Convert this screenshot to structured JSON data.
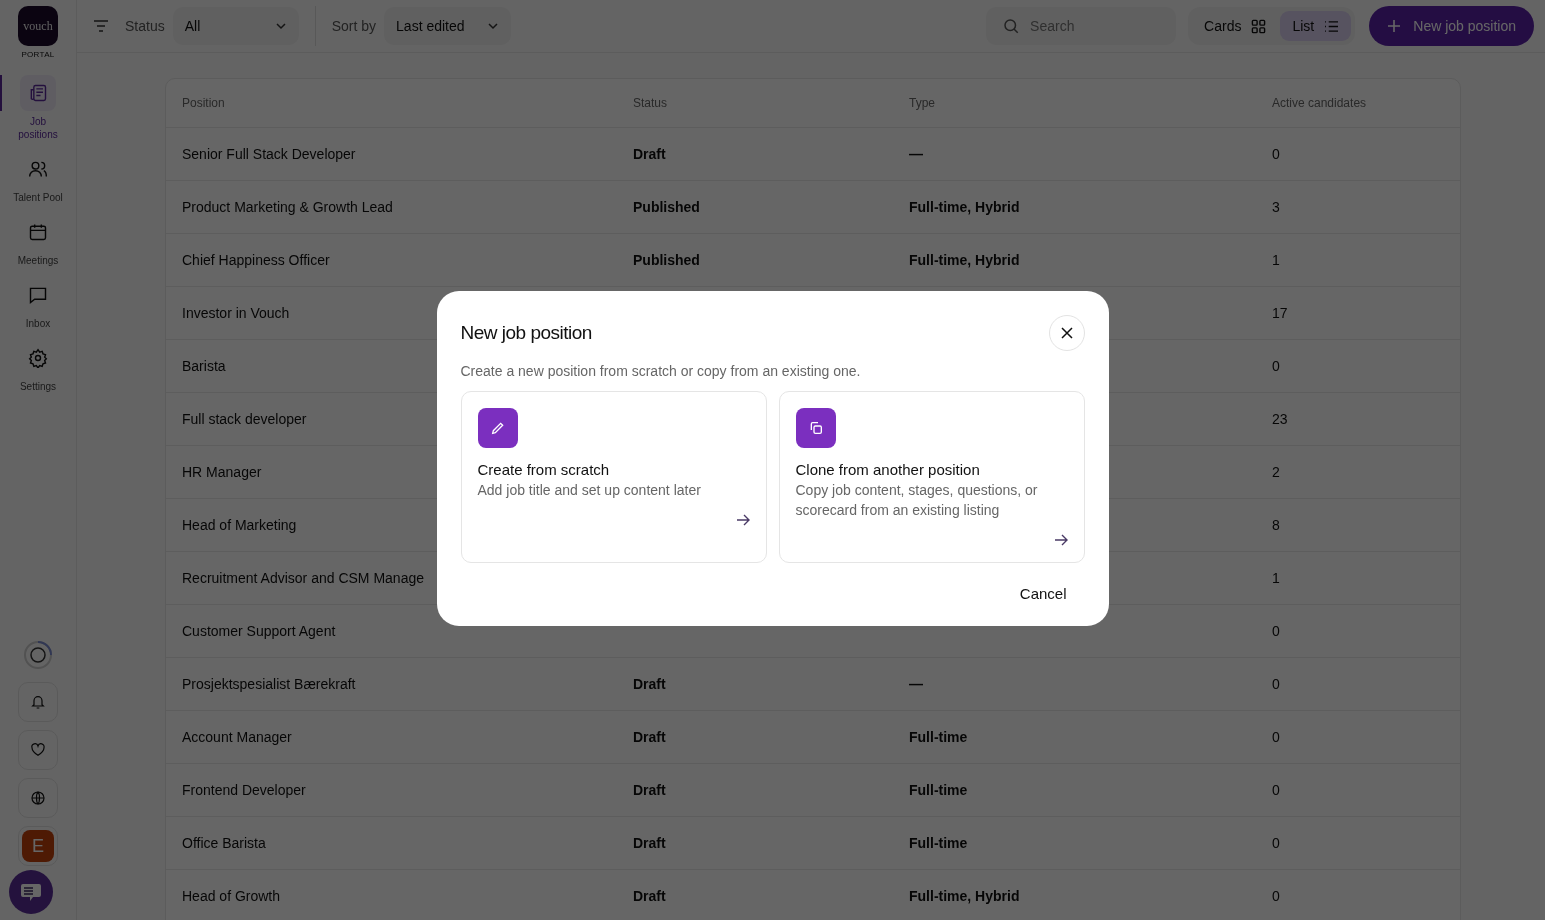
{
  "logo": {
    "text": "vouch",
    "caption": "PORTAL"
  },
  "sidebar": {
    "items": [
      {
        "label": "Job positions",
        "selected": true
      },
      {
        "label": "Talent Pool",
        "selected": false
      },
      {
        "label": "Meetings",
        "selected": false
      },
      {
        "label": "Inbox",
        "selected": false
      },
      {
        "label": "Settings",
        "selected": false
      }
    ],
    "avatar_initial": "E"
  },
  "toolbar": {
    "status_label": "Status",
    "status_value": "All",
    "sort_label": "Sort by",
    "sort_value": "Last edited",
    "search_placeholder": "Search",
    "views": [
      {
        "label": "Cards",
        "selected": false
      },
      {
        "label": "List",
        "selected": true
      }
    ],
    "new_button": "New job position"
  },
  "table": {
    "columns": [
      "Position",
      "Status",
      "Type",
      "Active candidates"
    ],
    "rows": [
      {
        "position": "Senior Full Stack Developer",
        "status": "Draft",
        "type": "—",
        "candidates": "0"
      },
      {
        "position": "Product Marketing & Growth Lead",
        "status": "Published",
        "type": "Full-time, Hybrid",
        "candidates": "3"
      },
      {
        "position": "Chief Happiness Officer",
        "status": "Published",
        "type": "Full-time, Hybrid",
        "candidates": "1"
      },
      {
        "position": "Investor in Vouch",
        "candidates": "17"
      },
      {
        "position": "Barista",
        "candidates": "0"
      },
      {
        "position": "Full stack developer",
        "candidates": "23"
      },
      {
        "position": "HR Manager",
        "candidates": "2"
      },
      {
        "position": "Head of Marketing",
        "candidates": "8"
      },
      {
        "position": "Recruitment Advisor and CSM Manage",
        "candidates": "1"
      },
      {
        "position": "Customer Support Agent",
        "candidates": "0"
      },
      {
        "position": "Prosjektspesialist Bærekraft",
        "status": "Draft",
        "type": "—",
        "candidates": "0"
      },
      {
        "position": "Account Manager",
        "status": "Draft",
        "type": "Full-time",
        "candidates": "0"
      },
      {
        "position": "Frontend Developer",
        "status": "Draft",
        "type": "Full-time",
        "candidates": "0"
      },
      {
        "position": "Office Barista",
        "status": "Draft",
        "type": "Full-time",
        "candidates": "0"
      },
      {
        "position": "Head of Growth",
        "status": "Draft",
        "type": "Full-time, Hybrid",
        "candidates": "0"
      }
    ]
  },
  "dialog": {
    "title": "New job position",
    "subtitle": "Create a new position from scratch or copy from an existing one.",
    "options": [
      {
        "title": "Create from scratch",
        "description": "Add job title and set up content later"
      },
      {
        "title": "Clone from another position",
        "description": "Copy job content, stages, questions, or scorecard from an existing listing"
      }
    ],
    "cancel": "Cancel"
  }
}
